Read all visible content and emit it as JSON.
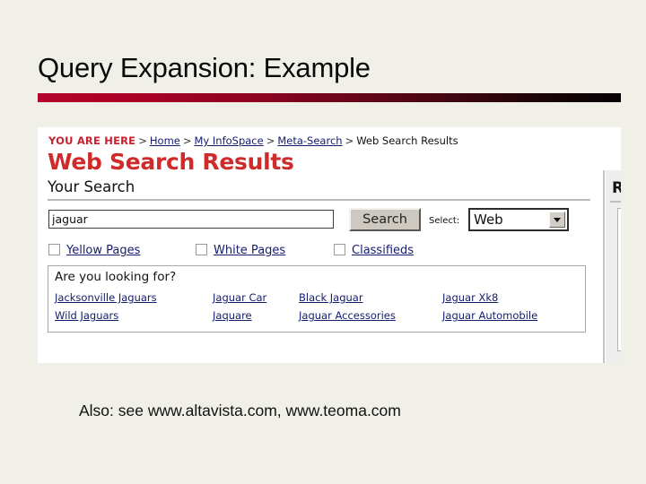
{
  "slide": {
    "title": "Query Expansion: Example",
    "caption": "Also: see www.altavista.com, www.teoma.com",
    "accent_color_start": "#b4032a",
    "accent_color_end": "#050203",
    "background_color": "#f1f0e8"
  },
  "screenshot": {
    "breadcrumb": {
      "prefix": "YOU ARE HERE",
      "separator": ">",
      "links": [
        "Home",
        "My InfoSpace",
        "Meta-Search"
      ],
      "current": "Web Search Results"
    },
    "page_heading": "Web Search Results",
    "page_heading_color": "#cf2b2b",
    "section_label": "Your Search",
    "search": {
      "query_value": "jaguar",
      "placeholder": "",
      "search_button_label": "Search",
      "select_label": "Select:",
      "select_value": "Web",
      "select_options": [
        "Web"
      ]
    },
    "checkboxes": [
      {
        "label": "Yellow Pages",
        "checked": false
      },
      {
        "label": "White Pages",
        "checked": false
      },
      {
        "label": "Classifieds",
        "checked": false
      }
    ],
    "suggestions": {
      "title": "Are you looking for?",
      "rows": [
        [
          "Jacksonville Jaguars",
          "Jaguar Car",
          "Black Jaguar",
          "Jaguar Xk8"
        ],
        [
          "Wild Jaguars",
          "Jaquare",
          "Jaguar Accessories",
          "Jaguar Automobile"
        ]
      ]
    },
    "right_rail": {
      "heading": "Re"
    },
    "link_color": "#141c6e"
  }
}
